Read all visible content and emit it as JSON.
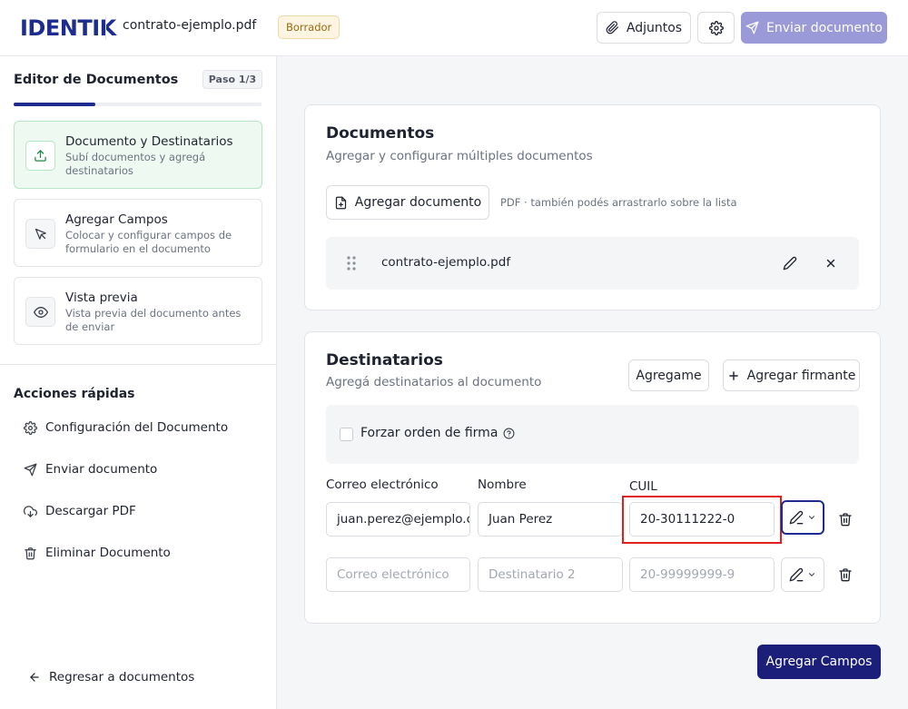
{
  "header": {
    "logo": "IDENTIK",
    "filename": "contrato-ejemplo.pdf",
    "status_badge": "Borrador",
    "attachments_label": "Adjuntos",
    "send_label": "Enviar documento"
  },
  "sidebar": {
    "title": "Editor de Documentos",
    "step_counter": "Paso 1/3",
    "progress": 0.33,
    "steps": [
      {
        "title": "Documento y Destinatarios",
        "desc": "Subí documentos y agregá destinatarios",
        "icon": "upload-icon"
      },
      {
        "title": "Agregar Campos",
        "desc": "Colocar y configurar campos de formulario en el documento",
        "icon": "cursor-icon"
      },
      {
        "title": "Vista previa",
        "desc": "Vista previa del documento antes de enviar",
        "icon": "eye-icon"
      }
    ],
    "quick_actions_title": "Acciones rápidas",
    "quick_actions": [
      {
        "label": "Configuración del Documento",
        "icon": "gear-icon"
      },
      {
        "label": "Enviar documento",
        "icon": "send-icon"
      },
      {
        "label": "Descargar PDF",
        "icon": "download-cloud-icon"
      },
      {
        "label": "Eliminar Documento",
        "icon": "trash-icon"
      }
    ],
    "back_label": "Regresar a documentos"
  },
  "documents": {
    "title": "Documentos",
    "subtitle": "Agregar y configurar múltiples documentos",
    "add_label": "Agregar documento",
    "hint": "PDF · también podés arrastrarlo sobre la lista",
    "items": [
      {
        "name": "contrato-ejemplo.pdf"
      }
    ]
  },
  "recipients": {
    "title": "Destinatarios",
    "subtitle": "Agregá destinatarios al documento",
    "add_me_label": "Agregame",
    "add_signer_label": "Agregar firmante",
    "force_order_label": "Forzar orden de firma",
    "columns": {
      "email": "Correo electrónico",
      "name": "Nombre",
      "cuil": "CUIL"
    },
    "rows": [
      {
        "email": "juan.perez@ejemplo.c",
        "name": "Juan Perez",
        "cuil": "20-30111222-0"
      },
      {
        "email": "",
        "email_placeholder": "Correo electrónico",
        "name": "",
        "name_placeholder": "Destinatario 2",
        "cuil": "",
        "cuil_placeholder": "20-99999999-9"
      }
    ]
  },
  "footer": {
    "next_label": "Agregar Campos"
  },
  "colors": {
    "brand": "#1d2d8f",
    "primary_button": "#1b1f7a",
    "send_button_disabled": "#9a9ad9",
    "highlight": "#e02020",
    "active_step_bg": "#eefaf1"
  }
}
